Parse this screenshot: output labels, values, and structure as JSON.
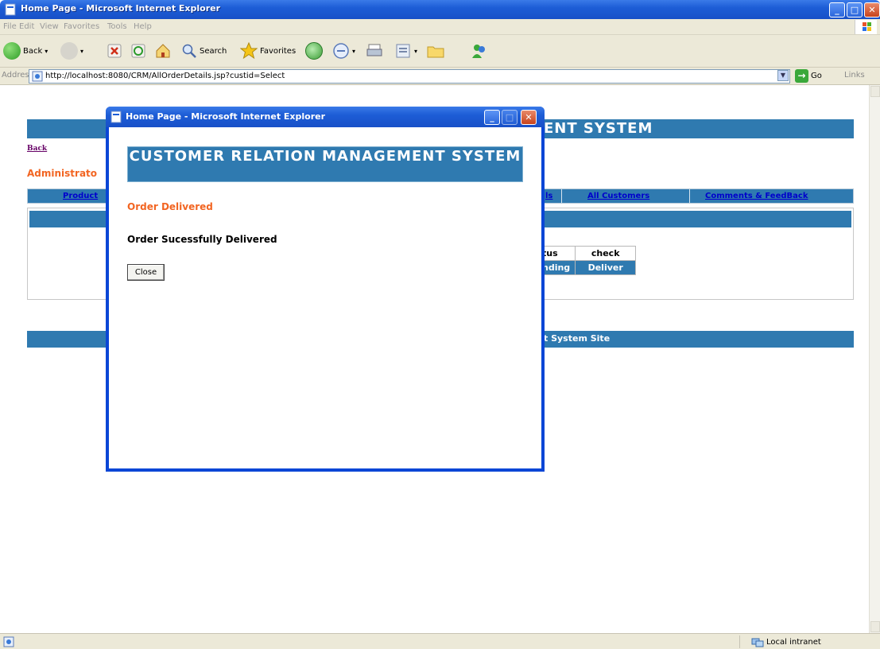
{
  "browser": {
    "title": "Home Page - Microsoft Internet Explorer",
    "menu": [
      "File",
      "Edit",
      "View",
      "Favorites",
      "Tools",
      "Help"
    ],
    "toolbar": {
      "back_label": "Back",
      "search_label": "Search",
      "favorites_label": "Favorites"
    },
    "address": {
      "label": "Address",
      "url": "http://localhost:8080/CRM/AllOrderDetails.jsp?custid=Select",
      "go_label": "Go",
      "links_label": "Links"
    },
    "status": {
      "zone": "Local intranet"
    }
  },
  "page": {
    "header_text": "ENT SYSTEM",
    "back_link": "Back",
    "admin_label": "Administrato",
    "nav": [
      "Product",
      "ls",
      "All Customers",
      "Comments & FeedBack"
    ],
    "table": {
      "headers": [
        "tus",
        "check"
      ],
      "row": [
        "nding",
        "Deliver"
      ]
    },
    "footer_text": "t System Site"
  },
  "popup": {
    "title": "Home Page - Microsoft Internet Explorer",
    "banner": "CUSTOMER RELATION MANAGEMENT SYSTEM",
    "status_title": "Order Delivered",
    "message": "Order Sucessfully Delivered",
    "close_label": "Close"
  },
  "colors": {
    "accent": "#2f7ab0",
    "orange": "#f26522",
    "xp_blue": "#1d5dd6"
  }
}
